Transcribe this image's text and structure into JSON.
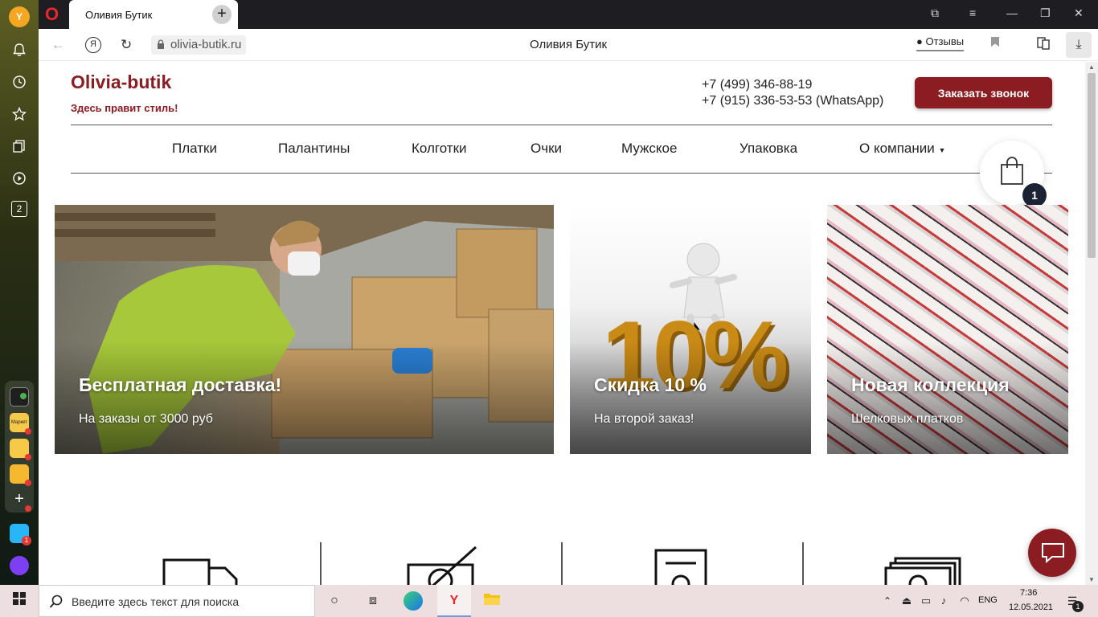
{
  "browser": {
    "tab_title": "Оливия Бутик",
    "url": "olivia-butik.ru",
    "page_title": "Оливия Бутик",
    "reviews_label": "Отзывы",
    "sidebar_badge": "2",
    "dock_app_label": "Маркет"
  },
  "site": {
    "logo": "Olivia-butik",
    "slogan": "Здесь правит стиль!",
    "phone1": "+7 (499) 346-88-19",
    "phone2": "+7 (915) 336-53-53 (WhatsApp)",
    "callback_label": "Заказать звонок",
    "menu": [
      "Платки",
      "Палантины",
      "Колготки",
      "Очки",
      "Мужское",
      "Упаковка",
      "О компании"
    ],
    "cart_count": "1",
    "banners": [
      {
        "title": "Бесплатная доставка!",
        "subtitle": "На заказы от 3000 руб"
      },
      {
        "title": "Скидка 10 %",
        "subtitle": "На второй заказ!"
      },
      {
        "title": "Новая коллекция",
        "subtitle": "Шелковых платков"
      }
    ],
    "promo_digits": "10%"
  },
  "taskbar": {
    "search_placeholder": "Введите здесь текст для поиска",
    "lang": "ENG",
    "time": "7:36",
    "date": "12.05.2021",
    "notif_count": "1",
    "messenger_badge": "1"
  },
  "colors": {
    "brand": "#8b1c22",
    "badge": "#1a2233"
  }
}
